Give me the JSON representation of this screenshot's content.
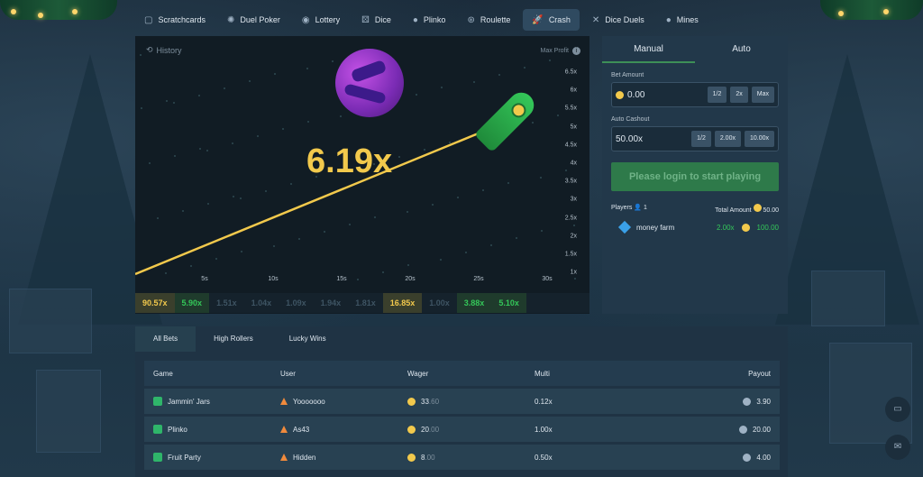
{
  "nav": {
    "items": [
      {
        "label": "Scratchcards",
        "icon": "scratchcard-icon",
        "glyph": "▢"
      },
      {
        "label": "Duel Poker",
        "icon": "poker-icon",
        "glyph": "✺"
      },
      {
        "label": "Lottery",
        "icon": "lottery-icon",
        "glyph": "◉"
      },
      {
        "label": "Dice",
        "icon": "dice-icon",
        "glyph": "⚄"
      },
      {
        "label": "Plinko",
        "icon": "plinko-icon",
        "glyph": "●"
      },
      {
        "label": "Roulette",
        "icon": "roulette-icon",
        "glyph": "⊛"
      },
      {
        "label": "Crash",
        "icon": "rocket-icon",
        "glyph": "🚀"
      },
      {
        "label": "Dice Duels",
        "icon": "swords-icon",
        "glyph": "✕"
      },
      {
        "label": "Mines",
        "icon": "mine-icon",
        "glyph": "●"
      }
    ],
    "active": "Crash"
  },
  "game": {
    "history_label": "History",
    "max_profit_label": "Max Profit",
    "multiplier": "6.19x",
    "y_ticks": [
      "6.5x",
      "6x",
      "5.5x",
      "5x",
      "4.5x",
      "4x",
      "3.5x",
      "3x",
      "2.5x",
      "2x",
      "1.5x",
      "1x"
    ],
    "x_ticks": [
      "5s",
      "10s",
      "15s",
      "20s",
      "25s",
      "30s"
    ]
  },
  "history_chips": [
    {
      "value": "90.57x",
      "tone": "yellow"
    },
    {
      "value": "5.90x",
      "tone": "green"
    },
    {
      "value": "1.51x",
      "tone": "gray"
    },
    {
      "value": "1.04x",
      "tone": "gray"
    },
    {
      "value": "1.09x",
      "tone": "gray"
    },
    {
      "value": "1.94x",
      "tone": "gray"
    },
    {
      "value": "1.81x",
      "tone": "gray"
    },
    {
      "value": "16.85x",
      "tone": "yellow"
    },
    {
      "value": "1.00x",
      "tone": "gray"
    },
    {
      "value": "3.88x",
      "tone": "green"
    },
    {
      "value": "5.10x",
      "tone": "green"
    }
  ],
  "panel": {
    "tabs": [
      "Manual",
      "Auto"
    ],
    "bet_amount_label": "Bet Amount",
    "bet_amount_value": "0.00",
    "bet_buttons": [
      "1/2",
      "2x",
      "Max"
    ],
    "auto_cashout_label": "Auto Cashout",
    "auto_cashout_value": "50.00x",
    "cashout_buttons": [
      "1/2",
      "2.00x",
      "10.00x"
    ],
    "login_label": "Please login to start playing",
    "players_label": "Players",
    "players_count": "1",
    "total_amount_label": "Total Amount",
    "total_amount_value": "50.00",
    "player": {
      "name": "money farm",
      "cashout": "2.00x",
      "amount": "100.00"
    }
  },
  "bets": {
    "tabs": [
      "All Bets",
      "High Rollers",
      "Lucky Wins"
    ],
    "columns": [
      "Game",
      "User",
      "Wager",
      "Multi",
      "Payout"
    ],
    "rows": [
      {
        "game": "Jammin' Jars",
        "user": "Yooooooo",
        "wager_int": "33",
        "wager_dec": ".60",
        "multi": "0.12x",
        "payout": "3.90"
      },
      {
        "game": "Plinko",
        "user": "As43",
        "wager_int": "20",
        "wager_dec": ".00",
        "multi": "1.00x",
        "payout": "20.00"
      },
      {
        "game": "Fruit Party",
        "user": "Hidden",
        "wager_int": "8",
        "wager_dec": ".00",
        "multi": "0.50x",
        "payout": "4.00"
      }
    ]
  },
  "colors": {
    "accent": "#2e7a4a",
    "yellow": "#f2c94c",
    "green": "#34c759"
  }
}
